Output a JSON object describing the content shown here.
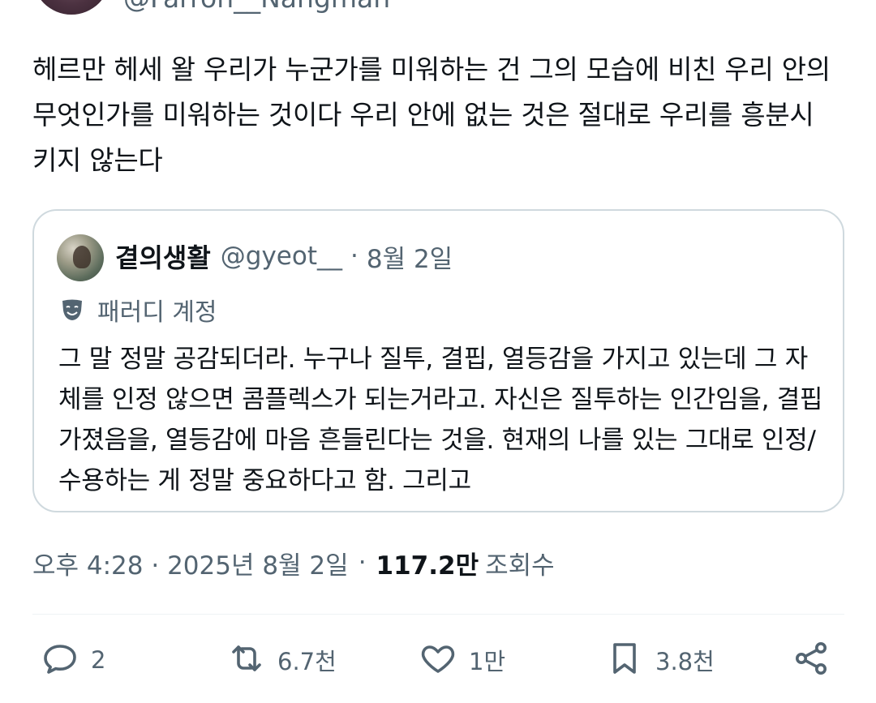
{
  "header": {
    "handle": "@Farron__Nangman"
  },
  "tweet": {
    "text": "헤르만 헤세 왈 우리가 누군가를 미워하는 건 그의 모습에 비친 우리 안의 무엇인가를 미워하는 것이다 우리 안에 없는 것은 절대로 우리를 흥분시키지 않는다"
  },
  "quote": {
    "name": "곁의생활",
    "handle": "@gyeot__",
    "dot": "·",
    "date": "8월 2일",
    "parody_label": "패러디 계정",
    "text": "그 말 정말 공감되더라. 누구나 질투, 결핍, 열등감을 가지고 있는데 그 자체를 인정 않으면 콤플렉스가 되는거라고. 자신은 질투하는 인간임을, 결핍 가졌음을, 열등감에 마음 흔들린다는 것을. 현재의 나를 있는 그대로 인정/수용하는 게 정말 중요하다고 함. 그리고"
  },
  "meta": {
    "time": "오후 4:28 · 2025년 8월 2일",
    "dot": "·",
    "views": "117.2만",
    "views_label": "조회수"
  },
  "actions": {
    "reply": {
      "icon": "reply-icon",
      "count": "2"
    },
    "retweet": {
      "icon": "retweet-icon",
      "count": "6.7천"
    },
    "like": {
      "icon": "heart-icon",
      "count": "1만"
    },
    "bookmark": {
      "icon": "bookmark-icon",
      "count": "3.8천"
    },
    "share": {
      "icon": "share-icon"
    }
  },
  "colors": {
    "text": "#0f1419",
    "secondary": "#536471",
    "border": "#cfd9de"
  }
}
